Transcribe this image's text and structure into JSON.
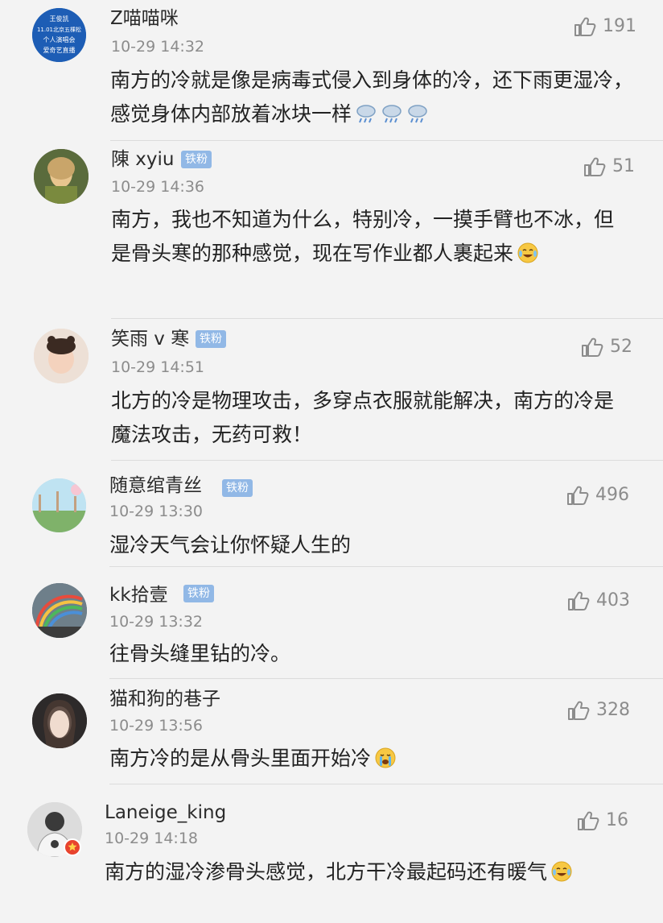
{
  "comments": [
    {
      "user": "Z喵喵咪",
      "badge": "",
      "time": "10-29 14:32",
      "likes": "191",
      "text": "南方的冷就是像是病毒式侵入到身体的冷，还下雨更湿冷，感觉身体内部放着冰块一样",
      "emoji": [
        "rain-cloud-icon",
        "rain-cloud-icon",
        "rain-cloud-icon"
      ],
      "avatar_text": [
        "王俊凯",
        "11.01北京五棵松",
        "个人演唱会",
        "爱奇艺直播"
      ]
    },
    {
      "user": "陳 xyiu",
      "badge": "铁粉",
      "time": "10-29 14:36",
      "likes": "51",
      "text": "南方，我也不知道为什么，特别冷，一摸手臂也不冰，但是骨头寒的那种感觉，现在写作业都人裹起来",
      "emoji": [
        "laughing-tears-icon"
      ]
    },
    {
      "user": "笑雨 v 寒",
      "badge": "铁粉",
      "time": "10-29 14:51",
      "likes": "52",
      "text": "北方的冷是物理攻击，多穿点衣服就能解决，南方的冷是魔法攻击，无药可救！",
      "emoji": []
    },
    {
      "user": "随意绾青丝",
      "badge": "铁粉",
      "time": "10-29 13:30",
      "likes": "496",
      "text": "湿冷天气会让你怀疑人生的",
      "emoji": []
    },
    {
      "user": "kk拾壹",
      "badge": "铁粉",
      "time": "10-29 13:32",
      "likes": "403",
      "text": "往骨头缝里钻的冷。",
      "emoji": []
    },
    {
      "user": "猫和狗的巷子",
      "badge": "",
      "time": "10-29 13:56",
      "likes": "328",
      "text": "南方冷的是从骨头里面开始冷",
      "emoji": [
        "crying-face-icon"
      ]
    },
    {
      "user": "Laneige_king",
      "badge": "",
      "time": "10-29 14:18",
      "likes": "16",
      "text": "南方的湿冷渗骨头感觉，北方干冷最起码还有暖气",
      "emoji": [
        "laughing-tears-icon"
      ]
    }
  ]
}
